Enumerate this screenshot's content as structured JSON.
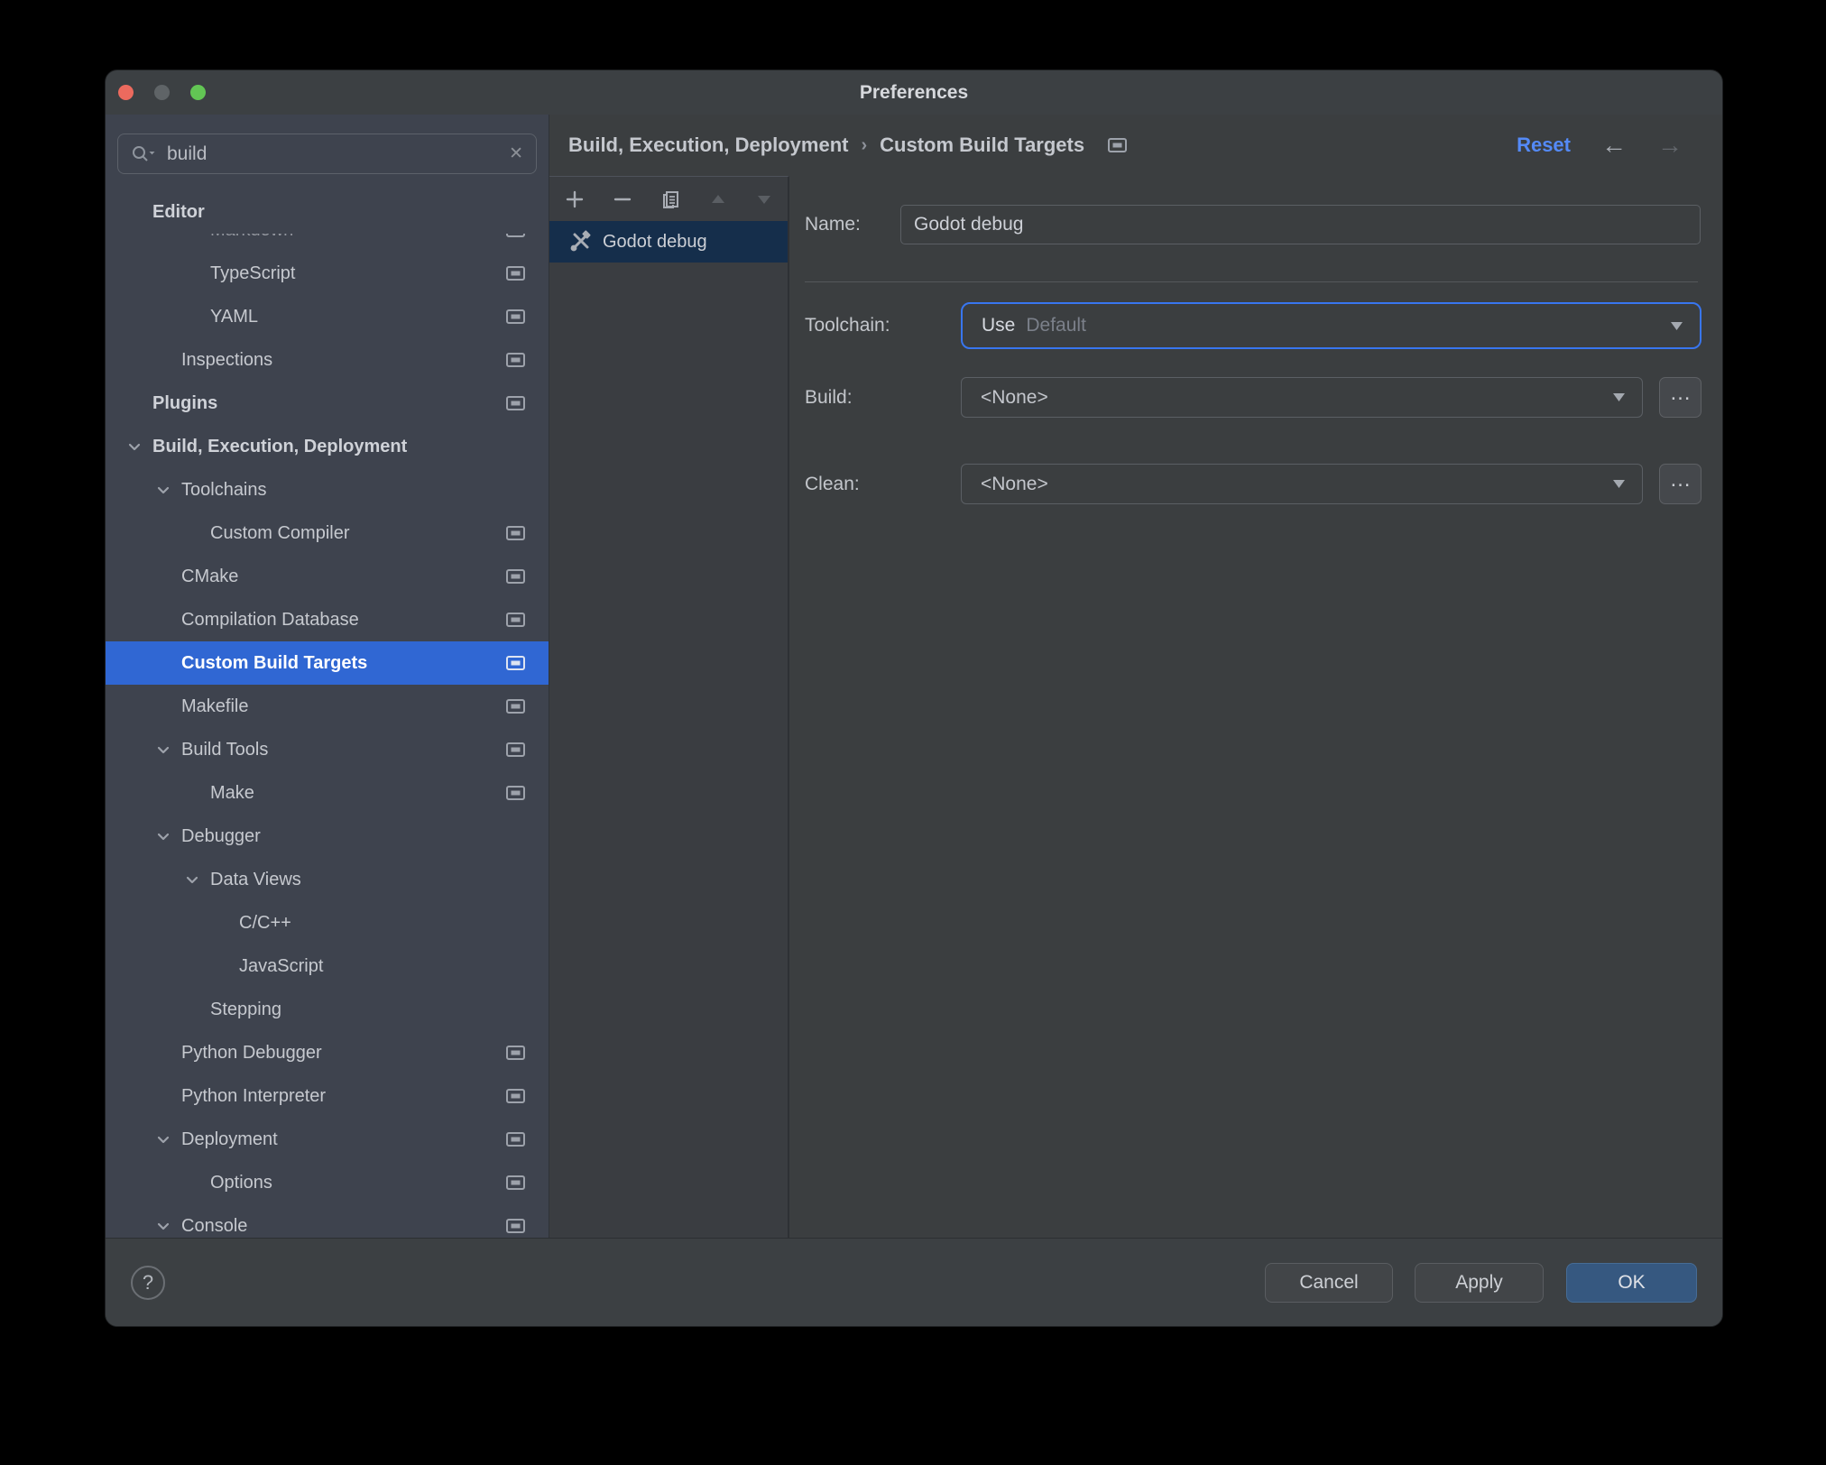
{
  "window": {
    "title": "Preferences"
  },
  "titlebar": {
    "traffic_lights": [
      {
        "name": "close",
        "color": "#EC6A5E"
      },
      {
        "name": "minimize",
        "color": "#5F6467"
      },
      {
        "name": "zoom",
        "color": "#62C554"
      }
    ]
  },
  "search": {
    "value": "build",
    "clear_icon": "✕"
  },
  "sidebar": {
    "items": [
      {
        "label": "Editor",
        "level": 0,
        "bold": true,
        "sticky": true
      },
      {
        "label": "Markdown",
        "level": 2,
        "icon": true,
        "faded": true,
        "overlap": true
      },
      {
        "label": "TypeScript",
        "level": 2,
        "icon": true
      },
      {
        "label": "YAML",
        "level": 2,
        "icon": true
      },
      {
        "label": "Inspections",
        "level": 1,
        "icon": true
      },
      {
        "label": "Plugins",
        "level": 0,
        "bold": true,
        "icon": true
      },
      {
        "label": "Build, Execution, Deployment",
        "level": 0,
        "bold": true,
        "chevron": true
      },
      {
        "label": "Toolchains",
        "level": 1,
        "chevron": true
      },
      {
        "label": "Custom Compiler",
        "level": 2,
        "icon": true
      },
      {
        "label": "CMake",
        "level": 1,
        "icon": true
      },
      {
        "label": "Compilation Database",
        "level": 1,
        "icon": true
      },
      {
        "label": "Custom Build Targets",
        "level": 1,
        "icon": true,
        "selected": true
      },
      {
        "label": "Makefile",
        "level": 1,
        "icon": true
      },
      {
        "label": "Build Tools",
        "level": 1,
        "chevron": true,
        "icon": true
      },
      {
        "label": "Make",
        "level": 2,
        "icon": true
      },
      {
        "label": "Debugger",
        "level": 1,
        "chevron": true
      },
      {
        "label": "Data Views",
        "level": 2,
        "chevron": true
      },
      {
        "label": "C/C++",
        "level": 3
      },
      {
        "label": "JavaScript",
        "level": 3
      },
      {
        "label": "Stepping",
        "level": 2
      },
      {
        "label": "Python Debugger",
        "level": 1,
        "icon": true
      },
      {
        "label": "Python Interpreter",
        "level": 1,
        "icon": true
      },
      {
        "label": "Deployment",
        "level": 1,
        "chevron": true,
        "icon": true
      },
      {
        "label": "Options",
        "level": 2,
        "icon": true
      },
      {
        "label": "Console",
        "level": 1,
        "chevron": true,
        "icon": true
      }
    ]
  },
  "header": {
    "breadcrumb": [
      "Build, Execution, Deployment",
      "Custom Build Targets"
    ],
    "separator": "›",
    "reset_label": "Reset",
    "back_icon": "←",
    "forward_icon": "→"
  },
  "list": {
    "toolbar": [
      {
        "name": "add",
        "icon": "plus",
        "enabled": true
      },
      {
        "name": "remove",
        "icon": "minus",
        "enabled": true
      },
      {
        "name": "duplicate",
        "icon": "copy",
        "enabled": true
      },
      {
        "name": "move-up",
        "icon": "tri-up",
        "enabled": false
      },
      {
        "name": "move-down",
        "icon": "tri-down",
        "enabled": false
      }
    ],
    "items": [
      {
        "label": "Godot debug",
        "selected": true,
        "icon": "build-tools"
      }
    ]
  },
  "form": {
    "name_label": "Name:",
    "name_value": "Godot debug",
    "toolchain_label": "Toolchain:",
    "toolchain_value": "Use",
    "toolchain_placeholder": "Default",
    "build_label": "Build:",
    "build_value": "<None>",
    "clean_label": "Clean:",
    "clean_value": "<None>",
    "more_label": "…"
  },
  "footer": {
    "help_label": "?",
    "cancel_label": "Cancel",
    "apply_label": "Apply",
    "ok_label": "OK"
  },
  "colors": {
    "tree_selection": "#3067D3",
    "focus_ring": "#3876F0",
    "reset_link": "#548AF7",
    "ok_button": "#365880",
    "list_selection": "#152E4B"
  }
}
